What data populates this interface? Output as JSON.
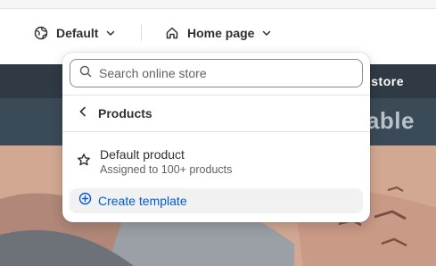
{
  "toolbar": {
    "theme_label": "Default",
    "page_label": "Home page"
  },
  "preview": {
    "announcement_text": "store",
    "heading_text": "able"
  },
  "popover": {
    "search": {
      "placeholder": "Search online store",
      "value": ""
    },
    "back_label": "Products",
    "items": [
      {
        "title": "Default product",
        "subtitle": "Assigned to 100+ products",
        "icon": "star-icon"
      }
    ],
    "create_label": "Create template"
  },
  "colors": {
    "accent": "#005bd3",
    "text": "#303030",
    "muted": "#616161",
    "banner_dark": "#2f3a44"
  }
}
